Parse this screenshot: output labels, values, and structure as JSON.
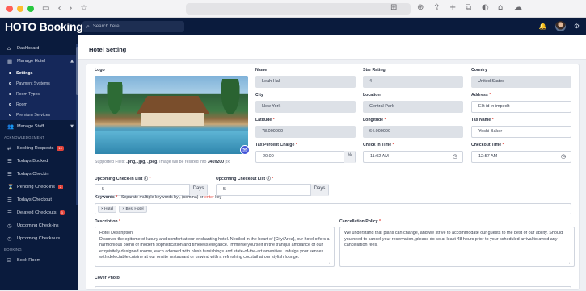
{
  "browser": {
    "icons": [
      "back-icon",
      "forward-icon",
      "star-icon"
    ]
  },
  "topnav": {
    "brand": "HOTO Booking",
    "search_placeholder": "Search here..."
  },
  "sidebar": {
    "items": [
      {
        "label": "Dashboard",
        "icon": "home-icon"
      },
      {
        "label": "Manage Hotel",
        "icon": "building-icon"
      }
    ],
    "sub_items": [
      "Settings",
      "Payment Systems",
      "Room Types",
      "Room",
      "Premium Services"
    ],
    "manage_staff": "Manage Staff",
    "section_acknowledgement": "ACKNOWLEDGEMENT",
    "ack_items": [
      {
        "label": "Booking Requests",
        "badge": "10"
      },
      {
        "label": "Todays Booked",
        "badge": ""
      },
      {
        "label": "Todays Checkin",
        "badge": ""
      },
      {
        "label": "Pending Check-ins",
        "badge": "2"
      },
      {
        "label": "Todays Checkout",
        "badge": ""
      },
      {
        "label": "Delayed Checkouts",
        "badge": "3"
      },
      {
        "label": "Upcoming Check-ins",
        "badge": ""
      },
      {
        "label": "Upcoming Checkouts",
        "badge": ""
      }
    ],
    "section_booking": "BOOKING",
    "booking_items": [
      {
        "label": "Book Room"
      }
    ]
  },
  "page": {
    "title": "Hotel Setting"
  },
  "form": {
    "logo_label": "Logo",
    "supported_note_prefix": "Supported Files: ",
    "supported_types": ".png, .jpg, .jpeg",
    "supported_note_mid": ". Image will be resized into ",
    "supported_size": "340x200",
    "supported_note_suffix": "px",
    "name_label": "Name",
    "name_value": "Leah Hall",
    "star_label": "Star Rating",
    "star_value": "4",
    "country_label": "Country",
    "country_value": "United States",
    "city_label": "City",
    "city_value": "New York",
    "location_label": "Location",
    "location_value": "Central Park",
    "address_label": "Address",
    "address_value": "Elit id in impedit",
    "latitude_label": "Latitude",
    "latitude_value": "78.000000",
    "longitude_label": "Longitude",
    "longitude_value": "64.000000",
    "taxname_label": "Tax Name",
    "taxname_value": "Yoshi Baker",
    "taxcharge_label": "Tax Percent Charge",
    "taxcharge_value": "20.00",
    "taxcharge_unit": "%",
    "checkin_label": "Check In Time",
    "checkin_value": "11:02 AM",
    "checkout_label": "Checkout Time",
    "checkout_value": "12:57 AM",
    "up_checkin_label": "Upcoming Check-in List",
    "up_checkin_value": "5",
    "up_checkin_unit": "Days",
    "up_checkout_label": "Upcoming Checkout List",
    "up_checkout_value": "5",
    "up_checkout_unit": "Days",
    "keywords_label": "Keywords",
    "keywords_hint_a": "Separate multiple keywords by ",
    "keywords_hint_b": ", (comma) or ",
    "keywords_hint_enter": "enter",
    "keywords_hint_c": " key",
    "keywords": [
      "Hotel",
      "Best Hotel"
    ],
    "description_label": "Description",
    "description_value": "Hotel Description:\nDiscover the epitome of luxury and comfort at our enchanting hotel. Nestled in the heart of [City/Area], our hotel offers a harmonious blend of modern sophistication and timeless elegance. Immerse yourself in the tranquil ambiance of our exquisitely designed rooms, each adorned with plush furnishings and state-of-the-art amenities. Indulge your senses with delectable cuisine at our onsite restaurant or unwind with a refreshing cocktail at our stylish lounge.",
    "cancel_label": "Cancellation Policy",
    "cancel_value": "We understand that plans can change, and we strive to accommodate our guests to the best of our ability. Should you need to cancel your reservation, please do so at least 48 hours prior to your scheduled arrival to avoid any cancellation fees.",
    "cover_label": "Cover Photo"
  },
  "colors": {
    "nav_bg": "#0a1b3d",
    "accent": "#3f51d8",
    "danger": "#e2433a"
  }
}
